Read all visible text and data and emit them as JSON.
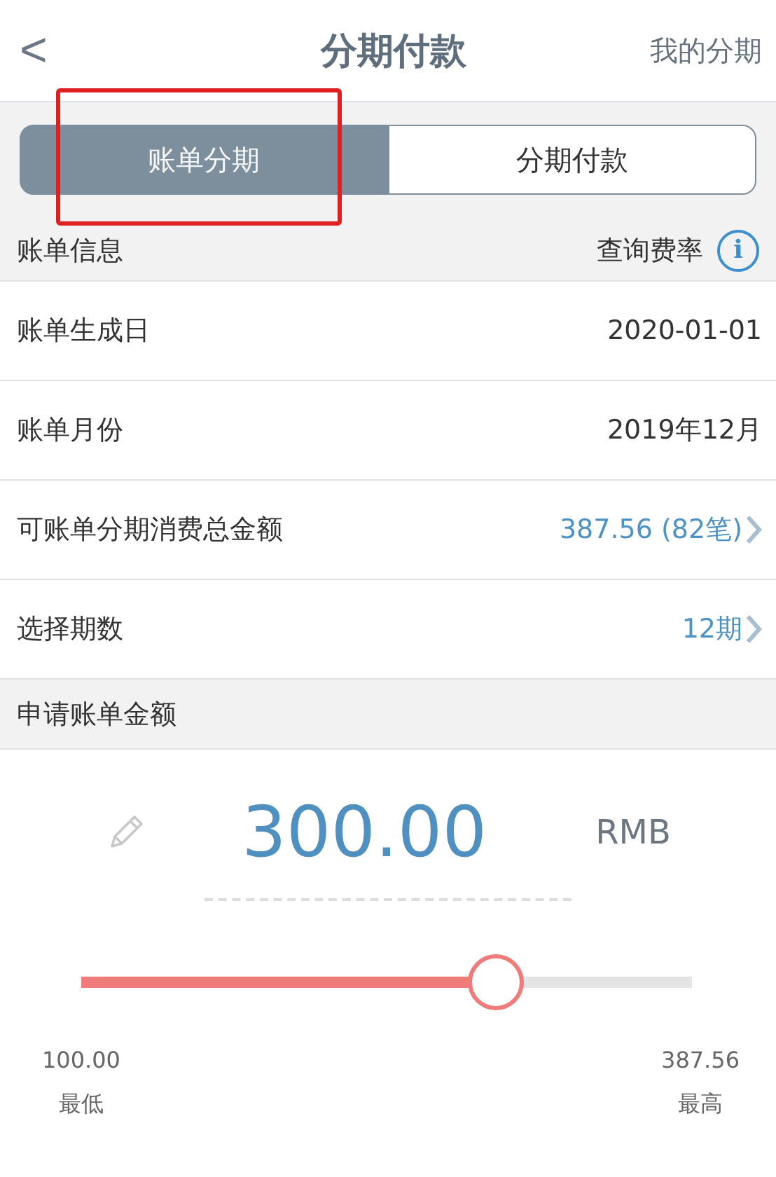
{
  "nav": {
    "back": "<",
    "title": "分期付款",
    "action": "我的分期"
  },
  "tabs": [
    {
      "label": "账单分期",
      "selected": true,
      "highlighted": true
    },
    {
      "label": "分期付款",
      "selected": false,
      "highlighted": false
    }
  ],
  "info_header": {
    "title": "账单信息",
    "link": "查询费率",
    "icon": "i"
  },
  "rows": [
    {
      "label": "账单生成日",
      "value": "2020-01-01",
      "kind": "plain"
    },
    {
      "label": "账单月份",
      "value": "2019年12月",
      "kind": "plain"
    },
    {
      "label": "可账单分期消费总金额",
      "value": "387.56 (82笔)",
      "kind": "link"
    },
    {
      "label": "选择期数",
      "value": "12期",
      "kind": "link"
    }
  ],
  "amount_header": "申请账单金额",
  "amount": {
    "value": "300.00",
    "currency": "RMB"
  },
  "slider": {
    "level": 0.68,
    "min": "100.00",
    "max": "387.56",
    "min_label": "最低",
    "max_label": "最高"
  }
}
